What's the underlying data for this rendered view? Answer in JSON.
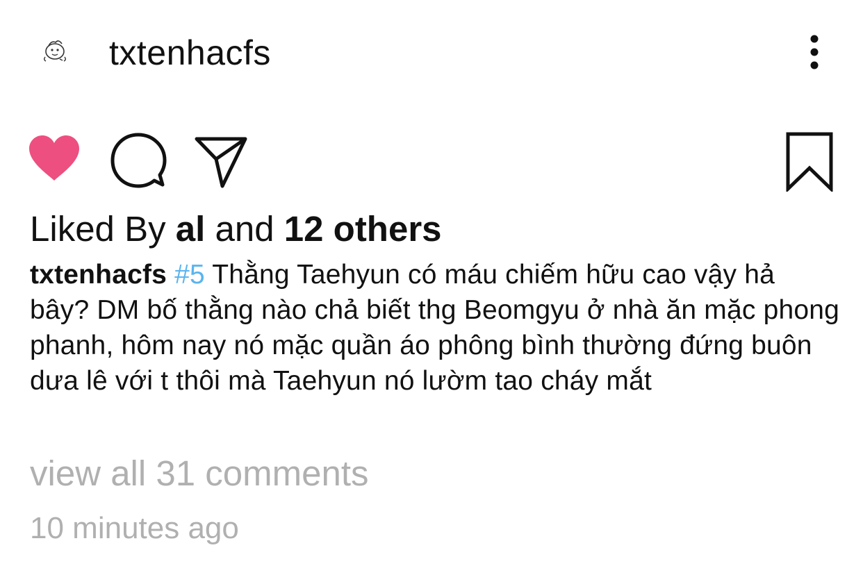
{
  "post": {
    "username": "txtenhacfs",
    "avatar_icon": "doodle-avatar-icon",
    "menu_icon": "more-vertical-icon"
  },
  "actions": {
    "like_icon": "heart-filled-icon",
    "comment_icon": "comment-bubble-icon",
    "share_icon": "paper-plane-icon",
    "save_icon": "bookmark-icon",
    "like_color": "#ed4f80",
    "liked": true
  },
  "likes": {
    "prefix": "Liked By",
    "user": "al",
    "connector": "and",
    "others": "12 others"
  },
  "caption": {
    "username": "txtenhacfs",
    "hashtag": "#5",
    "text": "Thằng Taehyun có máu chiếm hữu cao vậy hả bây? DM bố thằng nào chả biết thg Beomgyu ở nhà ăn mặc phong phanh, hôm nay nó mặc quần áo phông bình thường đứng buôn dưa lê với t thôi mà Taehyun nó lườm tao cháy mắt",
    "hashtag_color": "#5ab4ef"
  },
  "comments": {
    "link": "view all 31 comments"
  },
  "timestamp": "10 minutes ago"
}
